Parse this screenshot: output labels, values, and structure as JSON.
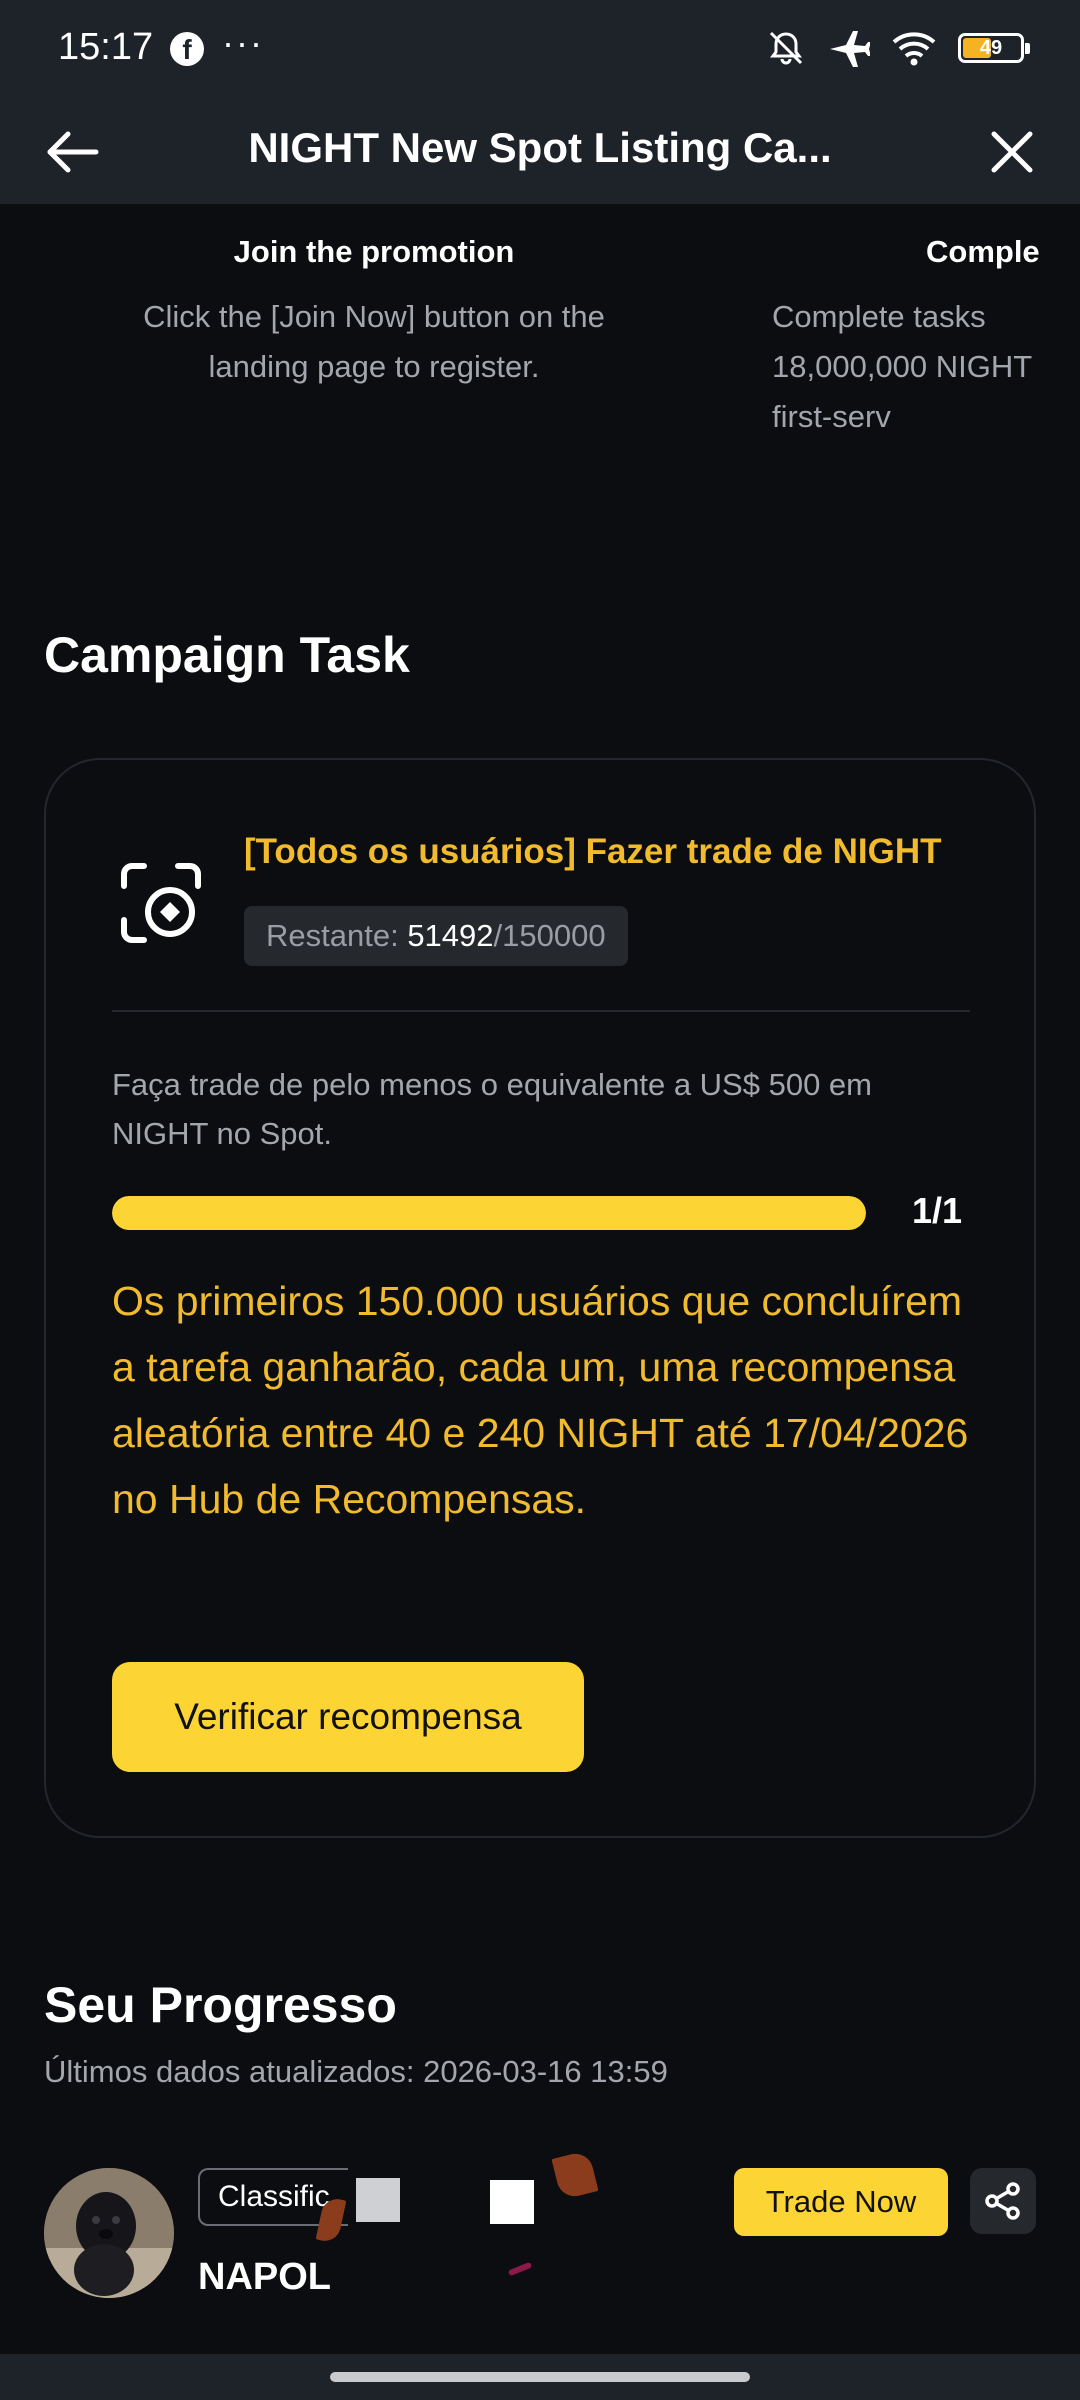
{
  "status_bar": {
    "time": "15:17",
    "app_icon": "facebook-icon",
    "overflow": "···",
    "icons": [
      "bell-off-icon",
      "airplane-icon",
      "wifi-icon"
    ],
    "battery": "49"
  },
  "nav": {
    "back_icon": "arrow-left-icon",
    "title": "NIGHT New Spot Listing Ca...",
    "close_icon": "close-icon"
  },
  "steps": [
    {
      "title": "Join the promotion",
      "description": "Click the [Join Now] button on the landing page to register."
    },
    {
      "title": "Comple",
      "description": "Complete tasks 18,000,000 NIGHT first-serv"
    }
  ],
  "campaign": {
    "section_title": "Campaign Task",
    "task": {
      "icon": "camera-scan-icon",
      "title": "[Todos os usuários] Fazer trade de NIGHT",
      "remaining_label": "Restante: ",
      "remaining_done": "51492",
      "remaining_total": "/150000",
      "description": "Faça trade de pelo menos o equivalente a US$ 500 em NIGHT no Spot.",
      "progress_fraction": 1.0,
      "progress_count": "1/1",
      "reward_text": "Os primeiros 150.000 usuários que concluírem a tarefa ganharão, cada um, uma recompensa aleatória entre 40 e 240 NIGHT até 17/04/2026 no Hub de Recompensas.",
      "verify_button": "Verificar recompensa"
    }
  },
  "progress": {
    "title": "Seu Progresso",
    "updated": "Últimos dados atualizados: 2026-03-16 13:59",
    "user": {
      "rank_label": "Classific",
      "name": "NAPOL"
    },
    "trade_button": "Trade Now",
    "share_icon": "share-icon"
  },
  "colors": {
    "accent": "#fcd535",
    "accent_text": "#f1bb2d",
    "background": "#0b0d10",
    "bar_background": "#1e2229"
  }
}
